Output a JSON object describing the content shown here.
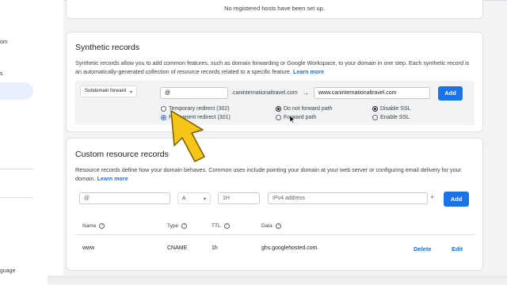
{
  "sidebar": {
    "items": [
      "om",
      "s",
      "guage"
    ]
  },
  "registered_hosts": {
    "empty_text": "No registered hosts have been set up."
  },
  "synthetic": {
    "title": "Synthetic records",
    "description": "Synthetic records allow you to add common features, such as domain forwarding or Google Workspace, to your domain in one step. Each synthetic record is an automatically-generated collection of resource records related to a specific feature.",
    "learn_more": "Learn more",
    "record_type": "Subdomain forward",
    "subdomain_value": "@",
    "domain_suffix": ".caninternationaltravel.com",
    "arrow": "→",
    "destination_value": "www.caninternationaltravel.com",
    "add_label": "Add",
    "options": {
      "temporary_redirect": "Temporary redirect (302)",
      "permanent_redirect": "Permanent redirect (301)",
      "do_not_forward_path": "Do not forward path",
      "forward_path": "Forward path",
      "disable_ssl": "Disable SSL",
      "enable_ssl": "Enable SSL"
    },
    "selected": {
      "redirect": "permanent",
      "path": "do_not_forward",
      "ssl": "disable"
    }
  },
  "custom": {
    "title": "Custom resource records",
    "description": "Resource records define how your domain behaves. Common uses include pointing your domain at your web server or configuring email delivery for your domain.",
    "learn_more": "Learn more",
    "name_placeholder": "@",
    "type_value": "A",
    "ttl_placeholder": "1H",
    "data_placeholder": "IPv4 address",
    "plus": "+",
    "add_label": "Add",
    "columns": [
      "Name",
      "Type",
      "TTL",
      "Data"
    ],
    "help_glyph": "?",
    "rows": [
      {
        "name": "www",
        "type": "CNAME",
        "ttl": "1h",
        "data": "ghs.googlehosted.com.",
        "delete": "Delete",
        "edit": "Edit"
      }
    ]
  },
  "colors": {
    "accent": "#1a73e8",
    "pointer_arrow": "#f5c518"
  },
  "icons": {
    "dropdown": "chevron-down-icon",
    "pointer": "arrow-pointer-icon",
    "help": "help-circle-icon",
    "cursor": "mouse-cursor-icon"
  }
}
